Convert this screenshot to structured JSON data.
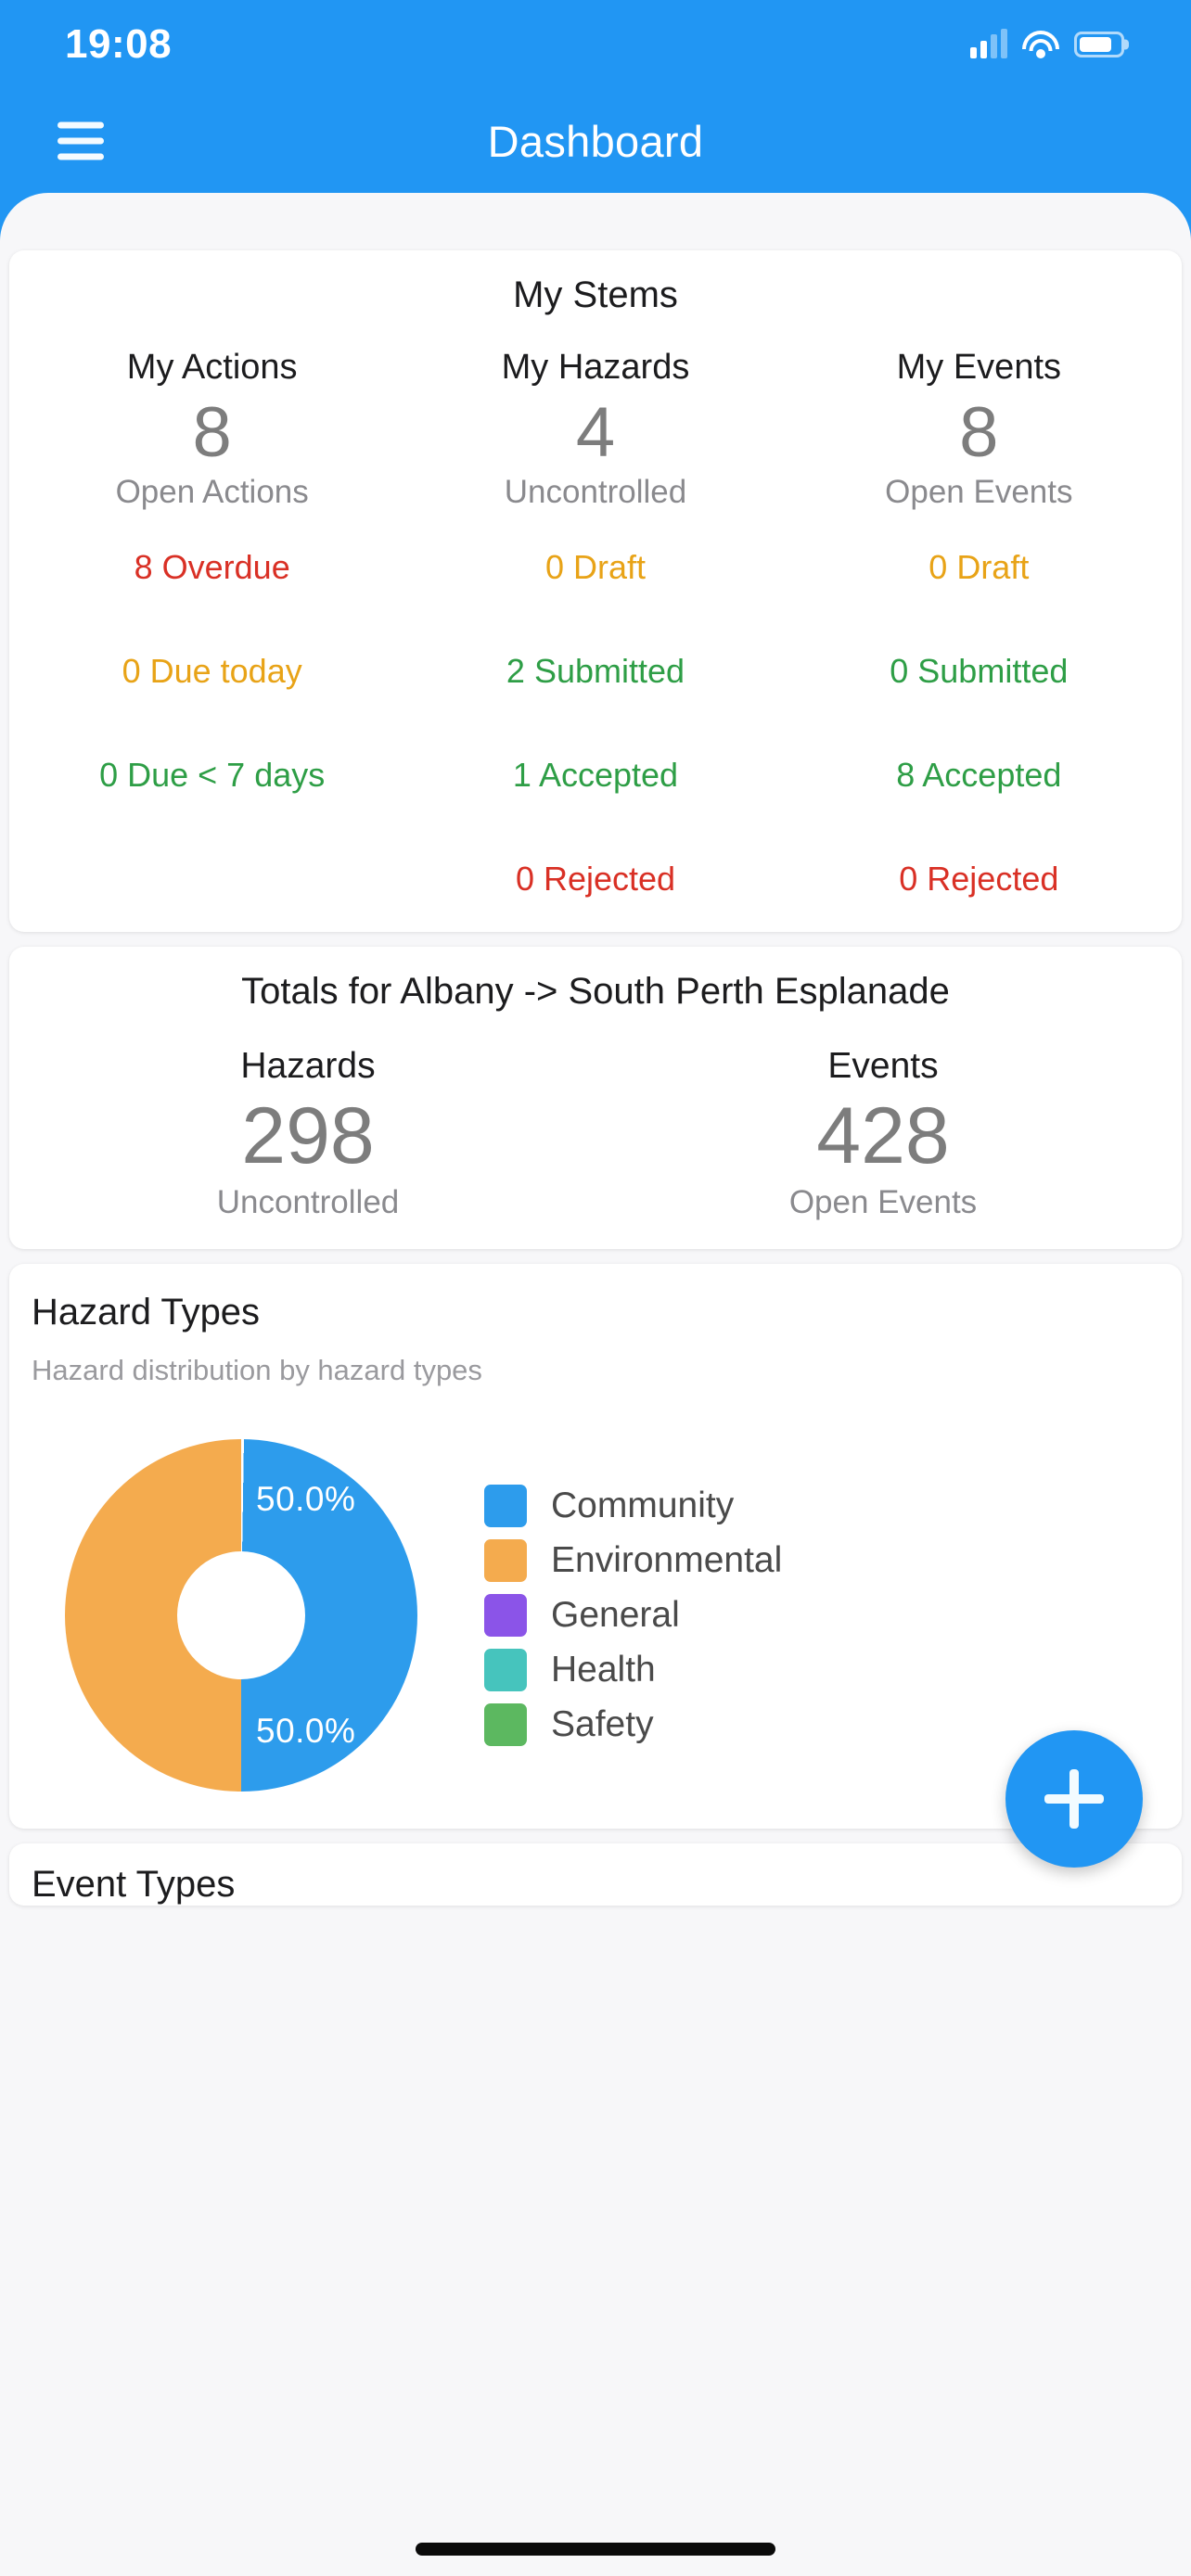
{
  "status_bar": {
    "time": "19:08",
    "icons": [
      "cellular-signal-icon",
      "wifi-icon",
      "battery-icon"
    ]
  },
  "nav": {
    "menu_icon": "hamburger-menu-icon",
    "title": "Dashboard"
  },
  "my_stems": {
    "title": "My Stems",
    "columns": [
      {
        "head": "My Actions",
        "value": "8",
        "sub": "Open Actions",
        "rows": [
          {
            "text": "8 Overdue",
            "color": "#d93025"
          },
          {
            "text": "0 Due today",
            "color": "#e8a317"
          },
          {
            "text": "0 Due < 7 days",
            "color": "#2e9e46"
          },
          {
            "text": "",
            "color": ""
          }
        ]
      },
      {
        "head": "My Hazards",
        "value": "4",
        "sub": "Uncontrolled",
        "rows": [
          {
            "text": "0 Draft",
            "color": "#e8a317"
          },
          {
            "text": "2 Submitted",
            "color": "#2e9e46"
          },
          {
            "text": "1 Accepted",
            "color": "#2e9e46"
          },
          {
            "text": "0 Rejected",
            "color": "#d93025"
          }
        ]
      },
      {
        "head": "My Events",
        "value": "8",
        "sub": "Open Events",
        "rows": [
          {
            "text": "0 Draft",
            "color": "#e8a317"
          },
          {
            "text": "0 Submitted",
            "color": "#2e9e46"
          },
          {
            "text": "8 Accepted",
            "color": "#2e9e46"
          },
          {
            "text": "0 Rejected",
            "color": "#d93025"
          }
        ]
      }
    ]
  },
  "totals": {
    "title": "Totals for Albany -> South Perth Esplanade",
    "columns": [
      {
        "head": "Hazards",
        "value": "298",
        "sub": "Uncontrolled"
      },
      {
        "head": "Events",
        "value": "428",
        "sub": "Open Events"
      }
    ]
  },
  "hazard_types": {
    "title": "Hazard Types",
    "subtitle": "Hazard distribution by hazard types",
    "slice_labels": {
      "top": "50.0%",
      "bottom": "50.0%"
    }
  },
  "event_types": {
    "title": "Event Types"
  },
  "fab": {
    "icon": "plus-icon",
    "label": "+"
  },
  "colors": {
    "brand_blue": "#2196f3",
    "community": "#2d9cec",
    "environmental": "#f4ab4e",
    "general": "#8b54e8",
    "health": "#46c4bd",
    "safety": "#5cb860",
    "red": "#d93025",
    "amber": "#e8a317",
    "green": "#2e9e46"
  },
  "chart_data": {
    "type": "pie",
    "title": "Hazard Types",
    "subtitle": "Hazard distribution by hazard types",
    "categories": [
      "Community",
      "Environmental",
      "General",
      "Health",
      "Safety"
    ],
    "values": [
      50.0,
      50.0,
      0,
      0,
      0
    ],
    "data_labels": [
      "50.0%",
      "50.0%"
    ],
    "colors": [
      "#2d9cec",
      "#f4ab4e",
      "#8b54e8",
      "#46c4bd",
      "#5cb860"
    ],
    "legend": [
      {
        "label": "Community",
        "color": "#2d9cec"
      },
      {
        "label": "Environmental",
        "color": "#f4ab4e"
      },
      {
        "label": "General",
        "color": "#8b54e8"
      },
      {
        "label": "Health",
        "color": "#46c4bd"
      },
      {
        "label": "Safety",
        "color": "#5cb860"
      }
    ],
    "legend_position": "right",
    "donut": true,
    "units": "percent"
  }
}
